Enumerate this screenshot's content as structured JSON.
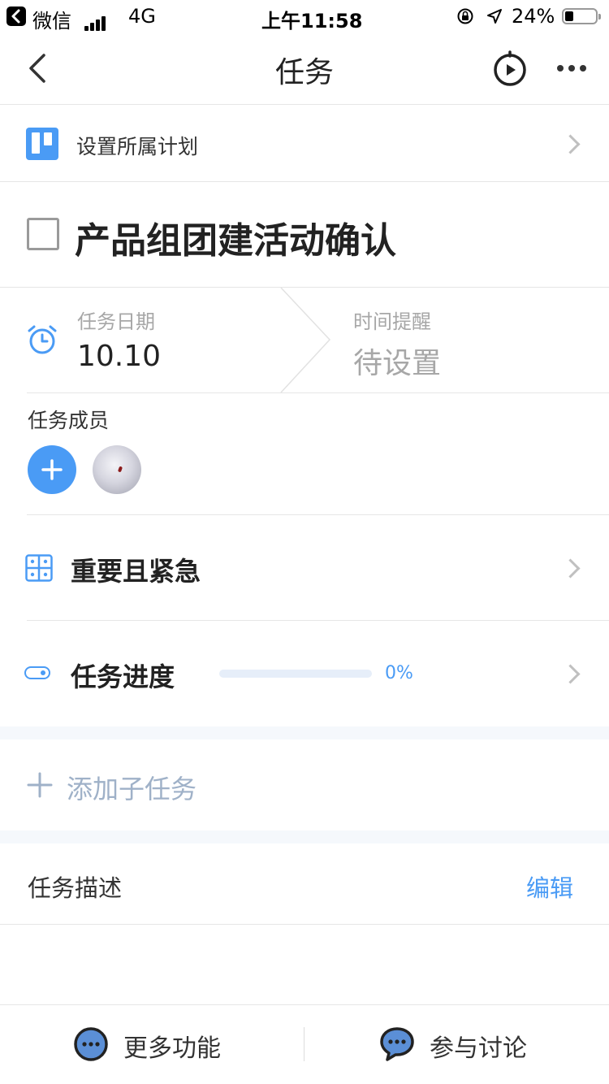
{
  "status_bar": {
    "back_app_label": "微信",
    "network": "4G",
    "time": "上午11:58",
    "battery": "24%"
  },
  "nav": {
    "title": "任务"
  },
  "plan": {
    "label": "设置所属计划"
  },
  "task": {
    "title": "产品组团建活动确认"
  },
  "date": {
    "label": "任务日期",
    "value": "10.10"
  },
  "reminder": {
    "label": "时间提醒",
    "value": "待设置"
  },
  "members": {
    "label": "任务成员"
  },
  "priority": {
    "label": "重要且紧急"
  },
  "progress": {
    "label": "任务进度",
    "value_text": "0%",
    "fraction": 0
  },
  "subtask": {
    "add_label": "添加子任务"
  },
  "description": {
    "label": "任务描述",
    "edit_label": "编辑"
  },
  "bottom_bar": {
    "more_label": "更多功能",
    "discuss_label": "参与讨论"
  },
  "colors": {
    "accent": "#4a9bf5",
    "muted_blue": "#9fb1c8",
    "divider": "#e6e6e6"
  }
}
